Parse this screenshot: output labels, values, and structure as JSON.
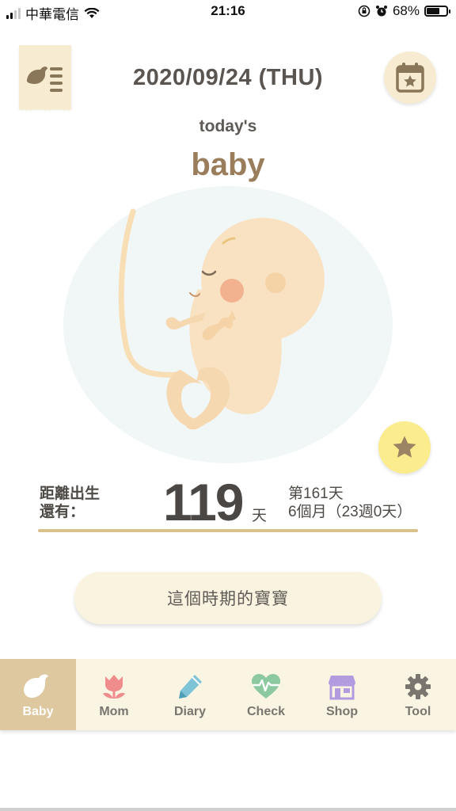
{
  "status": {
    "carrier": "中華電信",
    "time": "21:16",
    "battery": "68%",
    "battery_level": 0.68
  },
  "header": {
    "date": "2020/09/24 (THU)",
    "menu_icon": "bird-menu-icon",
    "calendar_icon": "calendar-star-icon"
  },
  "hero": {
    "subtitle": "today's",
    "title": "baby",
    "favorite_icon": "star-icon"
  },
  "countdown": {
    "label_line1": "距離出生",
    "label_line2": "還有：",
    "days": "119",
    "unit": "天",
    "day_index": "第161天",
    "age": "6個月（23週0天）"
  },
  "period_button": "這個時期的寶寶",
  "tabs": [
    {
      "label": "Baby",
      "icon": "bird-icon",
      "active": true,
      "color": "#ffffff"
    },
    {
      "label": "Mom",
      "icon": "tulip-icon",
      "active": false,
      "color": "#f08c8c"
    },
    {
      "label": "Diary",
      "icon": "pencil-icon",
      "active": false,
      "color": "#7fc3d6"
    },
    {
      "label": "Check",
      "icon": "heartbeat-icon",
      "active": false,
      "color": "#8dc9a0"
    },
    {
      "label": "Shop",
      "icon": "store-icon",
      "active": false,
      "color": "#b39be0"
    },
    {
      "label": "Tool",
      "icon": "gear-icon",
      "active": false,
      "color": "#7a756e"
    }
  ],
  "colors": {
    "accent": "#d9c28b",
    "tab_active": "#ddc8a0",
    "cream": "#f7ecd1",
    "star": "#fbed8d"
  }
}
